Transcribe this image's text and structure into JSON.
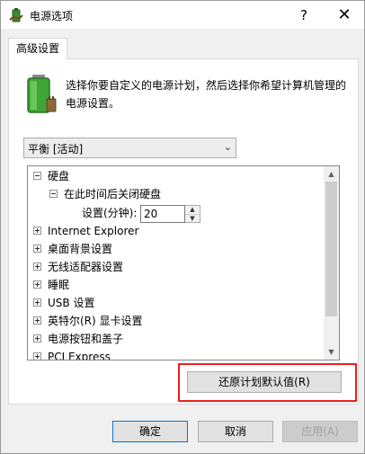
{
  "window": {
    "title": "电源选项",
    "help_glyph": "?",
    "close_glyph": "✕"
  },
  "tab": {
    "label": "高级设置"
  },
  "description": "选择你要自定义的电源计划，然后选择你希望计算机管理的电源设置。",
  "plan_select": {
    "value": "平衡 [活动]"
  },
  "tree": {
    "hard_disk": "硬盘",
    "turn_off_after": "在此时间后关闭硬盘",
    "setting_label": "设置(分钟):",
    "setting_value": "20",
    "items": [
      "Internet Explorer",
      "桌面背景设置",
      "无线适配器设置",
      "睡眠",
      "USB 设置",
      "英特尔(R) 显卡设置",
      "电源按钮和盖子",
      "PCI Express"
    ]
  },
  "buttons": {
    "restore": "还原计划默认值(R)",
    "ok": "确定",
    "cancel": "取消",
    "apply": "应用(A)"
  },
  "colors": {
    "highlight": "#e8211e",
    "accent": "#0078d7"
  }
}
